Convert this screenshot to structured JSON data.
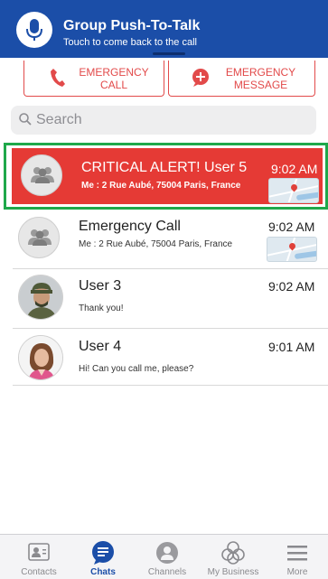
{
  "header": {
    "title": "Group Push-To-Talk",
    "subtitle": "Touch to come back to the call",
    "icon": "microphone-icon",
    "color": "#1b4ea8"
  },
  "emergency": {
    "call_label": "EMERGENCY CALL",
    "message_label": "EMERGENCY MESSAGE",
    "color": "#e24a4a"
  },
  "search": {
    "placeholder": "Search",
    "value": ""
  },
  "chats": [
    {
      "name": "CRITICAL ALERT! User 5",
      "time": "9:02 AM",
      "preview": "Me : 2 Rue Aubé, 75004 Paris, France",
      "avatar": "group-icon",
      "has_map": true,
      "highlight": true,
      "highlight_color": "#e53a35"
    },
    {
      "name": "Emergency Call",
      "time": "9:02 AM",
      "preview": "Me : 2 Rue Aubé, 75004 Paris, France",
      "avatar": "group-icon",
      "has_map": true
    },
    {
      "name": "User 3",
      "time": "9:02 AM",
      "preview": "Thank you!",
      "avatar": "soldier-photo"
    },
    {
      "name": "User 4",
      "time": "9:01 AM",
      "preview": "Hi! Can you call me, please?",
      "avatar": "woman-photo"
    }
  ],
  "tabs": [
    {
      "label": "Contacts",
      "icon": "contacts-icon"
    },
    {
      "label": "Chats",
      "icon": "chats-icon",
      "active": true
    },
    {
      "label": "Channels",
      "icon": "channels-icon"
    },
    {
      "label": "My Business",
      "icon": "business-icon"
    },
    {
      "label": "More",
      "icon": "menu-icon"
    }
  ]
}
